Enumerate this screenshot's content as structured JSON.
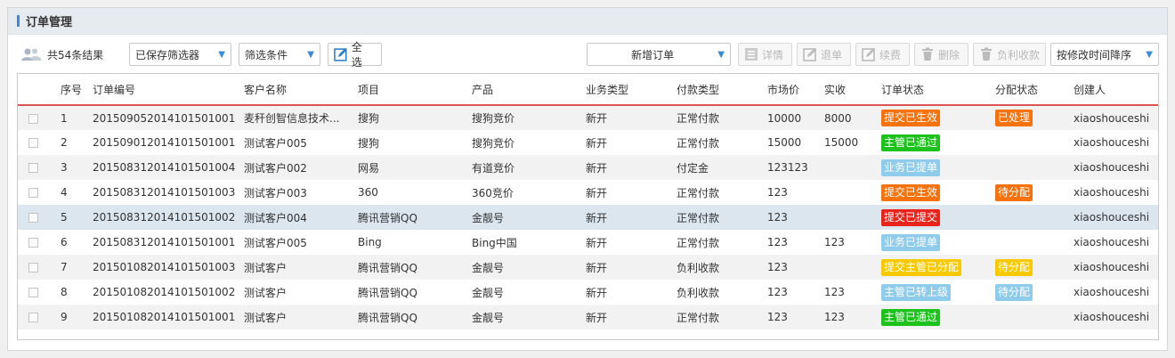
{
  "header": {
    "title": "订单管理"
  },
  "toolbar": {
    "result_text": "共54条结果",
    "saved_filter": "已保存筛选器",
    "filter_condition": "筛选条件",
    "select_all": "全 选",
    "new_order": "新增订单",
    "detail": "详情",
    "refund": "退单",
    "renew": "续费",
    "delete": "删除",
    "negative": "负利收款",
    "sort": "按修改时间降序"
  },
  "colors": {
    "orange": "#f5720c",
    "green": "#1dc21d",
    "lightblue": "#8fcbeb",
    "red": "#e8241d",
    "yellow": "#f9c900",
    "sortline": "#d9544f"
  },
  "table": {
    "columns": [
      "",
      "序号",
      "订单编号",
      "客户名称",
      "项目",
      "产品",
      "业务类型",
      "付款类型",
      "市场价",
      "实收",
      "订单状态",
      "分配状态",
      "创建人"
    ],
    "rows": [
      {
        "no": "1",
        "order": "20150905201410150100 1",
        "customer": "麦秆创智信息技术...",
        "project": "搜狗",
        "product": "搜狗竞价",
        "biz": "新开",
        "pay": "正常付款",
        "price": "10000",
        "paid": "8000",
        "status": "提交已生效",
        "status_color": "orange",
        "assign": "已处理",
        "assign_color": "orange",
        "creator": "xiaoshouceshi"
      },
      {
        "no": "2",
        "order": "20150901201410150100 1",
        "customer": "测试客户005",
        "project": "搜狗",
        "product": "搜狗竞价",
        "biz": "新开",
        "pay": "正常付款",
        "price": "15000",
        "paid": "15000",
        "status": "主管已通过",
        "status_color": "green",
        "assign": "",
        "assign_color": "",
        "creator": "xiaoshouceshi"
      },
      {
        "no": "3",
        "order": "20150831201410150100 4",
        "customer": "测试客户002",
        "project": "网易",
        "product": "有道竞价",
        "biz": "新开",
        "pay": "付定金",
        "price": "123123",
        "paid": "",
        "status": "业务已提单",
        "status_color": "lightblue",
        "assign": "",
        "assign_color": "",
        "creator": "xiaoshouceshi"
      },
      {
        "no": "4",
        "order": "20150831201410150100 3",
        "customer": "测试客户003",
        "project": "360",
        "product": "360竞价",
        "biz": "新开",
        "pay": "正常付款",
        "price": "123",
        "paid": "",
        "status": "提交已生效",
        "status_color": "orange",
        "assign": "待分配",
        "assign_color": "orange",
        "creator": "xiaoshouceshi"
      },
      {
        "no": "5",
        "order": "20150831201410150100 2",
        "customer": "测试客户004",
        "project": "腾讯营销QQ",
        "product": "金靓号",
        "biz": "新开",
        "pay": "正常付款",
        "price": "123",
        "paid": "",
        "status": "提交已提交",
        "status_color": "red",
        "assign": "",
        "assign_color": "",
        "creator": "xiaoshouceshi"
      },
      {
        "no": "6",
        "order": "20150831201410150100 1",
        "customer": "测试客户005",
        "project": "Bing",
        "product": "Bing中国",
        "biz": "新开",
        "pay": "正常付款",
        "price": "123",
        "paid": "123",
        "status": "业务已提单",
        "status_color": "lightblue",
        "assign": "",
        "assign_color": "",
        "creator": "xiaoshouceshi"
      },
      {
        "no": "7",
        "order": "20150108201410150100 3",
        "customer": "测试客户",
        "project": "腾讯营销QQ",
        "product": "金靓号",
        "biz": "新开",
        "pay": "负利收款",
        "price": "123",
        "paid": "",
        "status": "提交主管已分配",
        "status_color": "yellow",
        "assign": "待分配",
        "assign_color": "yellow",
        "creator": "xiaoshouceshi"
      },
      {
        "no": "8",
        "order": "20150108201410150100 2",
        "customer": "测试客户",
        "project": "腾讯营销QQ",
        "product": "金靓号",
        "biz": "新开",
        "pay": "负利收款",
        "price": "123",
        "paid": "123",
        "status": "主管已转上级",
        "status_color": "lightblue",
        "assign": "待分配",
        "assign_color": "lightblue",
        "creator": "xiaoshouceshi"
      },
      {
        "no": "9",
        "order": "20150108201410150100 1",
        "customer": "测试客户",
        "project": "腾讯营销QQ",
        "product": "金靓号",
        "biz": "新开",
        "pay": "正常付款",
        "price": "123",
        "paid": "123",
        "status": "主管已通过",
        "status_color": "green",
        "assign": "",
        "assign_color": "",
        "creator": "xiaoshouceshi"
      }
    ]
  }
}
